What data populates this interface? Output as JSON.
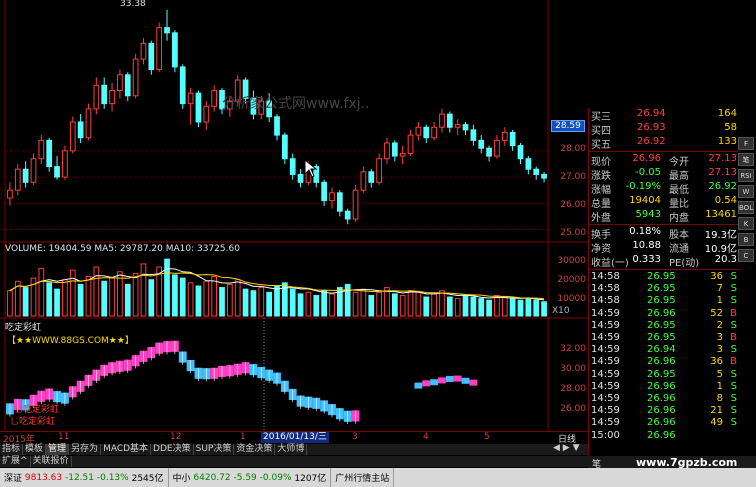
{
  "chart": {
    "peak_label": "33.38",
    "watermark": "分析家公式网www.fxj..",
    "price_box": "28.59",
    "y_price_ticks": [
      "28.00",
      "27.00",
      "26.00",
      "25.00"
    ],
    "volume_legend": "VOLUME: 19404.59  MA5: 29787.20  MA10: 33725.60",
    "y_vol_ticks": [
      "30000",
      "20000",
      "10000"
    ],
    "x10": "X10",
    "indicator_name": "吃定彩虹",
    "indicator_badge": "【★★WWW.88GS.COM★★】",
    "y_ind_ticks": [
      "32.00",
      "30.00",
      "28.00",
      "26.00"
    ],
    "red_note_1": "乚吃定彩虹",
    "red_note_2": "乚吃定彩虹",
    "x_labels": [
      "2015年",
      "11",
      "12",
      "1",
      "3",
      "4",
      "5"
    ],
    "date_highlight": "2016/01/13/三",
    "period": "日线",
    "colors": {
      "up": "#ff3c3c",
      "down": "#54ffff",
      "bg": "#000000",
      "ma5": "#ffffff",
      "ma10": "#ffd700",
      "rainbow_pink": "#ff40c0",
      "rainbow_blue": "#40c0ff"
    }
  },
  "chart_data": {
    "type": "candlestick",
    "title": "",
    "price_ylim": [
      24.6,
      33.6
    ],
    "volume_ylim": [
      0,
      38000
    ],
    "candles": [
      [
        26.2,
        26.8,
        25.9,
        26.5
      ],
      [
        26.5,
        27.5,
        26.3,
        27.3
      ],
      [
        27.3,
        27.6,
        26.6,
        26.8
      ],
      [
        26.8,
        27.9,
        26.7,
        27.7
      ],
      [
        27.7,
        28.6,
        27.5,
        28.4
      ],
      [
        28.4,
        28.5,
        27.2,
        27.4
      ],
      [
        27.4,
        27.8,
        26.9,
        27.0
      ],
      [
        27.0,
        28.2,
        26.9,
        28.0
      ],
      [
        28.0,
        29.3,
        27.9,
        29.1
      ],
      [
        29.1,
        29.4,
        28.3,
        28.5
      ],
      [
        28.5,
        29.8,
        28.4,
        29.6
      ],
      [
        29.6,
        30.8,
        29.4,
        30.5
      ],
      [
        30.5,
        30.8,
        29.6,
        29.8
      ],
      [
        29.8,
        30.6,
        29.5,
        30.3
      ],
      [
        30.3,
        31.1,
        30.0,
        30.9
      ],
      [
        30.9,
        31.0,
        29.9,
        30.1
      ],
      [
        30.1,
        31.7,
        30.0,
        31.5
      ],
      [
        31.5,
        32.3,
        31.3,
        32.1
      ],
      [
        32.1,
        32.2,
        30.9,
        31.1
      ],
      [
        31.1,
        32.9,
        31.0,
        32.7
      ],
      [
        32.7,
        33.38,
        32.2,
        32.5
      ],
      [
        32.5,
        32.6,
        31.0,
        31.2
      ],
      [
        31.2,
        31.3,
        29.6,
        29.8
      ],
      [
        29.8,
        30.4,
        29.0,
        30.2
      ],
      [
        30.2,
        30.3,
        28.9,
        29.1
      ],
      [
        29.1,
        29.9,
        28.8,
        29.7
      ],
      [
        29.7,
        30.5,
        29.5,
        30.3
      ],
      [
        30.3,
        30.4,
        29.4,
        29.6
      ],
      [
        29.6,
        30.1,
        29.3,
        29.9
      ],
      [
        29.9,
        30.9,
        29.7,
        30.7
      ],
      [
        30.7,
        30.8,
        29.8,
        30.0
      ],
      [
        30.0,
        30.3,
        29.2,
        29.4
      ],
      [
        29.4,
        30.1,
        29.2,
        29.9
      ],
      [
        29.9,
        30.2,
        29.1,
        29.3
      ],
      [
        29.3,
        29.4,
        28.4,
        28.6
      ],
      [
        28.6,
        28.7,
        27.5,
        27.7
      ],
      [
        27.7,
        27.9,
        26.9,
        27.1
      ],
      [
        27.1,
        27.3,
        26.6,
        26.8
      ],
      [
        26.8,
        27.6,
        26.7,
        27.4
      ],
      [
        27.4,
        27.5,
        26.6,
        26.8
      ],
      [
        26.8,
        26.9,
        25.9,
        26.1
      ],
      [
        26.1,
        26.6,
        25.8,
        26.4
      ],
      [
        26.4,
        26.5,
        25.5,
        25.7
      ],
      [
        25.7,
        25.8,
        25.2,
        25.4
      ],
      [
        25.4,
        26.7,
        25.3,
        26.5
      ],
      [
        26.5,
        27.4,
        26.4,
        27.2
      ],
      [
        27.2,
        27.3,
        26.6,
        26.8
      ],
      [
        26.8,
        27.9,
        26.7,
        27.7
      ],
      [
        27.7,
        28.5,
        27.5,
        28.3
      ],
      [
        28.3,
        28.4,
        27.6,
        27.8
      ],
      [
        27.8,
        28.2,
        27.5,
        27.9
      ],
      [
        27.9,
        28.8,
        27.8,
        28.6
      ],
      [
        28.6,
        29.1,
        28.4,
        28.9
      ],
      [
        28.9,
        29.0,
        28.3,
        28.5
      ],
      [
        28.5,
        29.1,
        28.4,
        28.9
      ],
      [
        28.9,
        29.6,
        28.7,
        29.4
      ],
      [
        29.4,
        29.5,
        28.7,
        28.9
      ],
      [
        28.9,
        29.2,
        28.6,
        29.0
      ],
      [
        29.0,
        29.1,
        28.6,
        28.8
      ],
      [
        28.8,
        29.0,
        28.2,
        28.4
      ],
      [
        28.4,
        28.6,
        27.9,
        28.1
      ],
      [
        28.1,
        28.2,
        27.6,
        27.8
      ],
      [
        27.8,
        28.6,
        27.7,
        28.4
      ],
      [
        28.4,
        28.9,
        28.2,
        28.7
      ],
      [
        28.7,
        28.8,
        28.0,
        28.2
      ],
      [
        28.2,
        28.3,
        27.5,
        27.7
      ],
      [
        27.7,
        27.8,
        27.1,
        27.3
      ],
      [
        27.3,
        27.4,
        26.9,
        27.1
      ],
      [
        27.1,
        27.2,
        26.8,
        26.96
      ]
    ],
    "volume": [
      16000,
      22000,
      18000,
      24000,
      30000,
      21000,
      17000,
      23000,
      29000,
      20000,
      25000,
      31000,
      22000,
      24000,
      28000,
      20000,
      27000,
      33000,
      23000,
      31000,
      36000,
      26000,
      24000,
      21000,
      19000,
      22000,
      25000,
      18000,
      20000,
      23000,
      17000,
      16000,
      18000,
      15000,
      19000,
      21000,
      17000,
      14000,
      15000,
      13000,
      16000,
      14000,
      18000,
      20000,
      15000,
      17000,
      13000,
      15000,
      18000,
      14000,
      13000,
      16000,
      15000,
      12000,
      14000,
      16000,
      12000,
      11000,
      13000,
      12000,
      11000,
      10000,
      13000,
      12000,
      11000,
      10000,
      11000,
      10000,
      9000
    ]
  },
  "right_panel": {
    "asks": [
      {
        "label": "买三",
        "price": "26.94",
        "vol": "164"
      },
      {
        "label": "买四",
        "price": "26.93",
        "vol": "58"
      },
      {
        "label": "买五",
        "price": "26.92",
        "vol": "133"
      }
    ],
    "quote": [
      {
        "l1": "现价",
        "v1": "26.96",
        "l2": "今开",
        "v2": "27.13"
      },
      {
        "l1": "涨跌",
        "v1": "-0.05",
        "l2": "最高",
        "v2": "27.13"
      },
      {
        "l1": "涨幅",
        "v1": "-0.19%",
        "l2": "最低",
        "v2": "26.92"
      },
      {
        "l1": "总量",
        "v1": "19404",
        "l2": "量比",
        "v2": "0.54"
      },
      {
        "l1": "外盘",
        "v1": "5943",
        "l2": "内盘",
        "v2": "13461"
      }
    ],
    "fund": [
      {
        "l1": "换手",
        "v1": "0.18%",
        "l2": "股本",
        "v2": "19.3亿"
      },
      {
        "l1": "净资",
        "v1": "10.88",
        "l2": "流通",
        "v2": "10.9亿"
      },
      {
        "l1": "收益(一)",
        "v1": "0.333",
        "l2": "PE(动)",
        "v2": "20.3"
      }
    ],
    "ticks": [
      {
        "t": "14:58",
        "p": "26.95",
        "v": "36",
        "s": "S"
      },
      {
        "t": "14:58",
        "p": "26.95",
        "v": "7",
        "s": "S"
      },
      {
        "t": "14:58",
        "p": "26.95",
        "v": "1",
        "s": "S"
      },
      {
        "t": "14:59",
        "p": "26.96",
        "v": "52",
        "s": "B"
      },
      {
        "t": "14:59",
        "p": "26.95",
        "v": "2",
        "s": "S"
      },
      {
        "t": "14:59",
        "p": "26.95",
        "v": "3",
        "s": "B"
      },
      {
        "t": "14:59",
        "p": "26.94",
        "v": "3",
        "s": "S"
      },
      {
        "t": "14:59",
        "p": "26.96",
        "v": "36",
        "s": "B"
      },
      {
        "t": "14:59",
        "p": "26.95",
        "v": "5",
        "s": "S"
      },
      {
        "t": "14:59",
        "p": "26.96",
        "v": "1",
        "s": "S"
      },
      {
        "t": "14:59",
        "p": "26.96",
        "v": "8",
        "s": "S"
      },
      {
        "t": "14:59",
        "p": "26.96",
        "v": "21",
        "s": "S"
      },
      {
        "t": "14:59",
        "p": "26.96",
        "v": "49",
        "s": "S"
      },
      {
        "t": "15:00",
        "p": "26.96",
        "v": "",
        "s": ""
      }
    ]
  },
  "side_tabs": [
    "F",
    "笔",
    "RSI",
    "W",
    "BOL",
    "K",
    "B",
    "C"
  ],
  "tabs": [
    "指标",
    "模板",
    "管理",
    "另存为",
    "MACD基本",
    "DDE决策",
    "SUP决策",
    "资金决策",
    "大师博"
  ],
  "tabs2": [
    "扩展^",
    "关联报价"
  ],
  "bottom_tab": "笔",
  "status": {
    "sz_label": "深证",
    "sz_val": "9813.63",
    "sz_chg": "-12.51",
    "sz_pct": "-0.13%",
    "sz_vol": "2545亿",
    "zx_label": "中小",
    "zx_val": "6420.72",
    "zx_chg": "-5.59",
    "zx_pct": "-0.09%",
    "zx_vol": "1207亿",
    "server": "广州行情主站"
  },
  "site": "www.7gpzb.com"
}
